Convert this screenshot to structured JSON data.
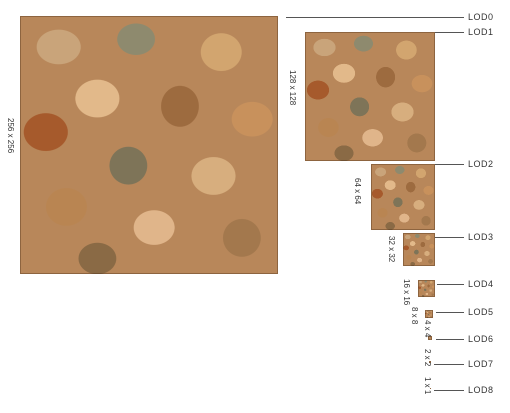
{
  "levels": [
    {
      "name": "LOD0",
      "size": "256 x 256"
    },
    {
      "name": "LOD1",
      "size": "128 x 128"
    },
    {
      "name": "LOD2",
      "size": "64 x 64"
    },
    {
      "name": "LOD3",
      "size": "32 x 32"
    },
    {
      "name": "LOD4",
      "size": "16 x 16"
    },
    {
      "name": "LOD5",
      "size": "8 x 8"
    },
    {
      "name": "LOD6",
      "size": "4 x 4"
    },
    {
      "name": "LOD7",
      "size": "2 x 2"
    },
    {
      "name": "LOD8",
      "size": "1 x 1"
    }
  ]
}
